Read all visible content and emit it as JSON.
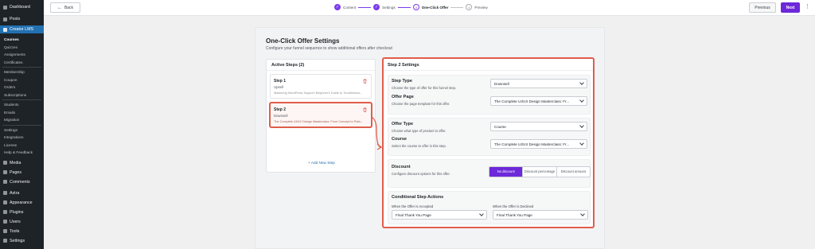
{
  "sidebar": {
    "items": [
      {
        "label": "Dashboard",
        "icon": "dashboard-icon"
      },
      {
        "label": "Posts",
        "icon": "pin-icon"
      },
      {
        "label": "Creator LMS",
        "icon": "lms-icon",
        "current": true
      }
    ],
    "lms_subitems": [
      "Courses",
      "Quizzes",
      "Assignments",
      "Certificates",
      "Membership",
      "Coupon",
      "Orders",
      "Subscriptions",
      "Students",
      "Emails",
      "Migration",
      "Settings",
      "Integrations",
      "License",
      "Help & Feedback"
    ],
    "bottom_items": [
      {
        "label": "Media",
        "icon": "media-icon"
      },
      {
        "label": "Pages",
        "icon": "pages-icon"
      },
      {
        "label": "Comments",
        "icon": "comments-icon"
      },
      {
        "label": "Astra",
        "icon": "astra-icon"
      },
      {
        "label": "Appearance",
        "icon": "brush-icon"
      },
      {
        "label": "Plugins",
        "icon": "plugin-icon"
      },
      {
        "label": "Users",
        "icon": "users-icon"
      },
      {
        "label": "Tools",
        "icon": "wrench-icon"
      },
      {
        "label": "Settings",
        "icon": "settings-icon"
      }
    ]
  },
  "topbar": {
    "back_label": "Back",
    "steps": [
      {
        "label": "Content",
        "state": "done"
      },
      {
        "label": "Settings",
        "state": "done"
      },
      {
        "label": "One-Click Offer",
        "state": "current",
        "number": "3"
      },
      {
        "label": "Preview",
        "state": "pending",
        "number": "4"
      }
    ],
    "previous_label": "Previous",
    "next_label": "Next"
  },
  "page": {
    "title": "One-Click Offer Settings",
    "subtitle": "Configure your funnel sequence to show additional offers after checkout"
  },
  "active_steps": {
    "heading": "Active Steps (2)",
    "steps": [
      {
        "name": "Step 1",
        "type": "Upsell",
        "course": "Mastering WordPress Support: Beginner's Guide to Troubleshoo..."
      },
      {
        "name": "Step 2",
        "type": "Downsell",
        "course": "The Complete UI/UX Design Masterclass: From Concept to Polis..."
      }
    ],
    "add_label": "+ Add New Step"
  },
  "settings": {
    "heading": "Step 2 Settings",
    "step_type": {
      "label": "Step Type",
      "help": "Choose the type of offer for this funnel step.",
      "value": "Downsell"
    },
    "offer_page": {
      "label": "Offer Page",
      "help": "Choose the page template for this offer.",
      "value": "The Complete UI/UX Design Masterclass: Fr..."
    },
    "offer_type": {
      "label": "Offer Type",
      "help": "Choose what type of product to offer.",
      "value": "Course"
    },
    "course": {
      "label": "Course",
      "help": "Select the course to offer in this step.",
      "value": "The Complete UI/UX Design Masterclass: Fr..."
    },
    "discount": {
      "label": "Discount",
      "help": "Configure discount options for this offer.",
      "options": [
        "No discount",
        "Discount percentage",
        "Discount amount"
      ],
      "selected": "No discount"
    },
    "conditional": {
      "label": "Conditional Step Actions",
      "accepted_label": "When the Offer is Accepted",
      "accepted_value": "Final Thank You Page",
      "declined_label": "When the Offer is Declined",
      "declined_value": "Final Thank You Page"
    }
  },
  "colors": {
    "accent": "#6d28d9",
    "highlight": "#e05d4b",
    "wp_sidebar": "#1d2327",
    "wp_current": "#2271b1"
  }
}
